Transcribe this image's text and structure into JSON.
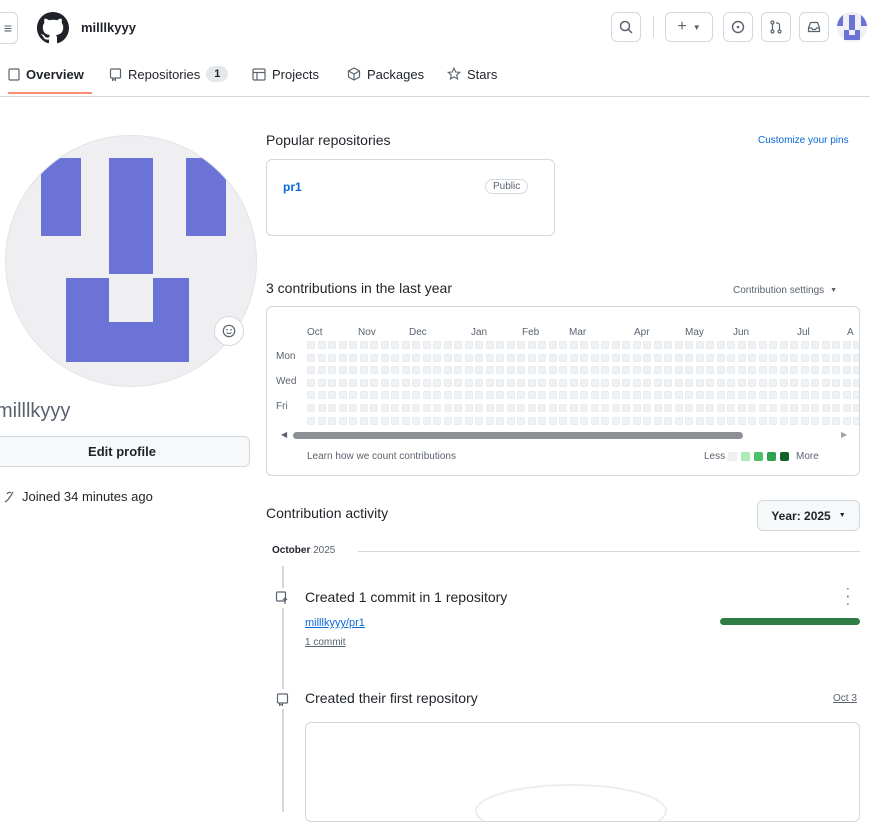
{
  "header": {
    "username": "milllkyyy"
  },
  "tabs": [
    {
      "label": "Overview"
    },
    {
      "label": "Repositories",
      "count": "1"
    },
    {
      "label": "Projects"
    },
    {
      "label": "Packages"
    },
    {
      "label": "Stars"
    }
  ],
  "profile": {
    "username": "milllkyyy",
    "edit_button": "Edit profile",
    "joined": "Joined 34 minutes ago",
    "avatar_color": "#6c73d6"
  },
  "popular": {
    "title": "Popular repositories",
    "customize": "Customize your pins",
    "repo_name": "pr1",
    "repo_badge": "Public"
  },
  "contrib": {
    "title": "3 contributions in the last year",
    "settings": "Contribution settings",
    "months": [
      "Oct",
      "Nov",
      "Dec",
      "Jan",
      "Feb",
      "Mar",
      "Apr",
      "May",
      "Jun",
      "Jul",
      "A"
    ],
    "days": [
      "Mon",
      "Wed",
      "Fri"
    ],
    "learn_link": "Learn how we count contributions",
    "less": "Less",
    "more": "More",
    "legend_colors": [
      "#eff2f5",
      "#aceebb",
      "#4ac26b",
      "#2da44e",
      "#116329"
    ]
  },
  "activity": {
    "title": "Contribution activity",
    "year_button": "Year: 2025",
    "month": "October",
    "year": "2025",
    "item1_title": "Created 1 commit in 1 repository",
    "item1_repo": "milllkyyy/pr1",
    "item1_commits": "1 commit",
    "item1_progress": 1.0,
    "item2_title": "Created their first repository",
    "item2_date": "Oct 3"
  },
  "colors": {
    "accent_tab": "#fd8c73",
    "link": "#0969da",
    "green": "#1a7f37"
  }
}
